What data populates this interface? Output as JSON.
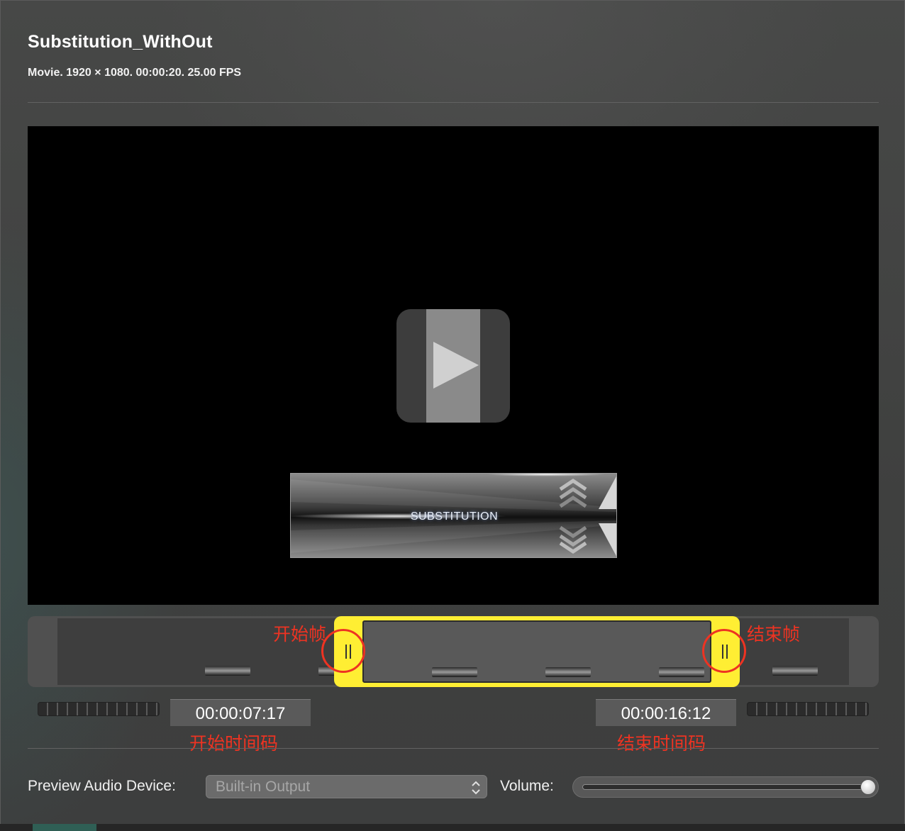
{
  "header": {
    "title": "Substitution_WithOut",
    "info": "Movie. 1920 × 1080. 00:00:20. 25.00 FPS"
  },
  "preview": {
    "play_icon": "play-icon",
    "overlay_text": "SUBSTITUTION"
  },
  "trim": {
    "start_annotation": "开始帧",
    "end_annotation": "结束帧",
    "start_timecode": "00:00:07:17",
    "end_timecode": "00:00:16:12",
    "start_timecode_annotation": "开始时间码",
    "end_timecode_annotation": "结束时间码"
  },
  "audio": {
    "device_label": "Preview Audio Device:",
    "device_value": "Built-in Output",
    "volume_label": "Volume:",
    "volume_level": 1.0
  },
  "colors": {
    "selection": "#ffee33",
    "annotation": "#ee3322"
  }
}
